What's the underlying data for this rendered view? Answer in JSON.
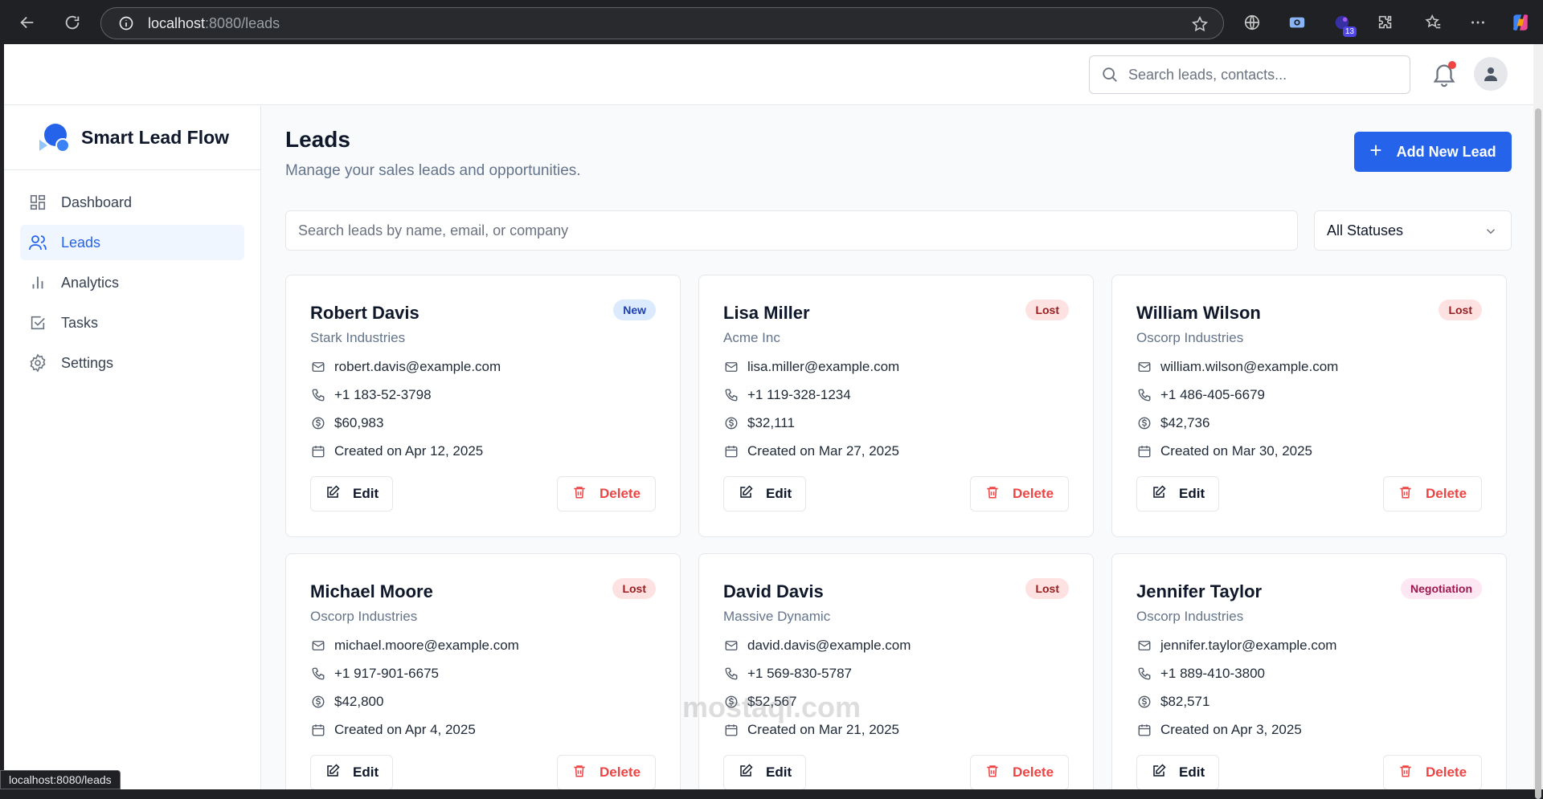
{
  "browser": {
    "url_host": "localhost",
    "url_path": ":8080/leads",
    "extension_badge": "13",
    "status_url": "localhost:8080/leads"
  },
  "header": {
    "search_placeholder": "Search leads, contacts..."
  },
  "sidebar": {
    "brand": "Smart Lead Flow",
    "items": [
      {
        "label": "Dashboard",
        "icon": "grid-icon",
        "active": false
      },
      {
        "label": "Leads",
        "icon": "users-icon",
        "active": true
      },
      {
        "label": "Analytics",
        "icon": "bar-chart-icon",
        "active": false
      },
      {
        "label": "Tasks",
        "icon": "checkbox-icon",
        "active": false
      },
      {
        "label": "Settings",
        "icon": "gear-icon",
        "active": false
      }
    ]
  },
  "main": {
    "title": "Leads",
    "subtitle": "Manage your sales leads and opportunities.",
    "add_button": "Add New Lead",
    "filter_placeholder": "Search leads by name, email, or company",
    "status_filter": "All Statuses",
    "edit_label": "Edit",
    "delete_label": "Delete"
  },
  "leads": [
    {
      "name": "Robert Davis",
      "company": "Stark Industries",
      "status": "New",
      "email": "robert.davis@example.com",
      "phone": "+1 183-52-3798",
      "value": "$60,983",
      "created": "Created on Apr 12, 2025"
    },
    {
      "name": "Lisa Miller",
      "company": "Acme Inc",
      "status": "Lost",
      "email": "lisa.miller@example.com",
      "phone": "+1 119-328-1234",
      "value": "$32,111",
      "created": "Created on Mar 27, 2025"
    },
    {
      "name": "William Wilson",
      "company": "Oscorp Industries",
      "status": "Lost",
      "email": "william.wilson@example.com",
      "phone": "+1 486-405-6679",
      "value": "$42,736",
      "created": "Created on Mar 30, 2025"
    },
    {
      "name": "Michael Moore",
      "company": "Oscorp Industries",
      "status": "Lost",
      "email": "michael.moore@example.com",
      "phone": "+1 917-901-6675",
      "value": "$42,800",
      "created": "Created on Apr 4, 2025"
    },
    {
      "name": "David Davis",
      "company": "Massive Dynamic",
      "status": "Lost",
      "email": "david.davis@example.com",
      "phone": "+1 569-830-5787",
      "value": "$52,567",
      "created": "Created on Mar 21, 2025"
    },
    {
      "name": "Jennifer Taylor",
      "company": "Oscorp Industries",
      "status": "Negotiation",
      "email": "jennifer.taylor@example.com",
      "phone": "+1 889-410-3800",
      "value": "$82,571",
      "created": "Created on Apr 3, 2025"
    }
  ],
  "colors": {
    "primary": "#2563eb",
    "danger": "#ef4444",
    "badge_new": "#dbeafe",
    "badge_lost": "#fee2e2",
    "badge_negotiation": "#fce7f3"
  },
  "watermark": "mostaql.com"
}
